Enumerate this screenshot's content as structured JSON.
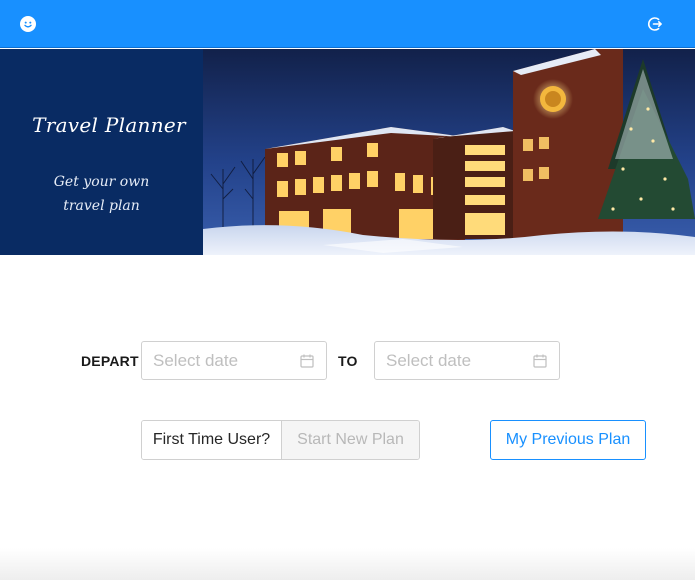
{
  "header": {
    "logo_icon": "smiley-logo-icon",
    "logout_icon": "logout-icon",
    "color": "#1890ff"
  },
  "banner": {
    "title": "Travel Planner",
    "subtitle_line1": "Get your own",
    "subtitle_line2": "travel plan",
    "panel_color": "#092b63",
    "photo": "snowy-campus-building-at-dusk"
  },
  "form": {
    "depart_label": "DEPART",
    "to_label": "TO",
    "depart_placeholder": "Select date",
    "return_placeholder": "Select date",
    "calendar_icon": "calendar-icon"
  },
  "actions": {
    "first_time_label": "First Time User?",
    "start_new_plan": "Start New Plan",
    "my_previous_plan": "My Previous Plan",
    "accent": "#1890ff"
  }
}
